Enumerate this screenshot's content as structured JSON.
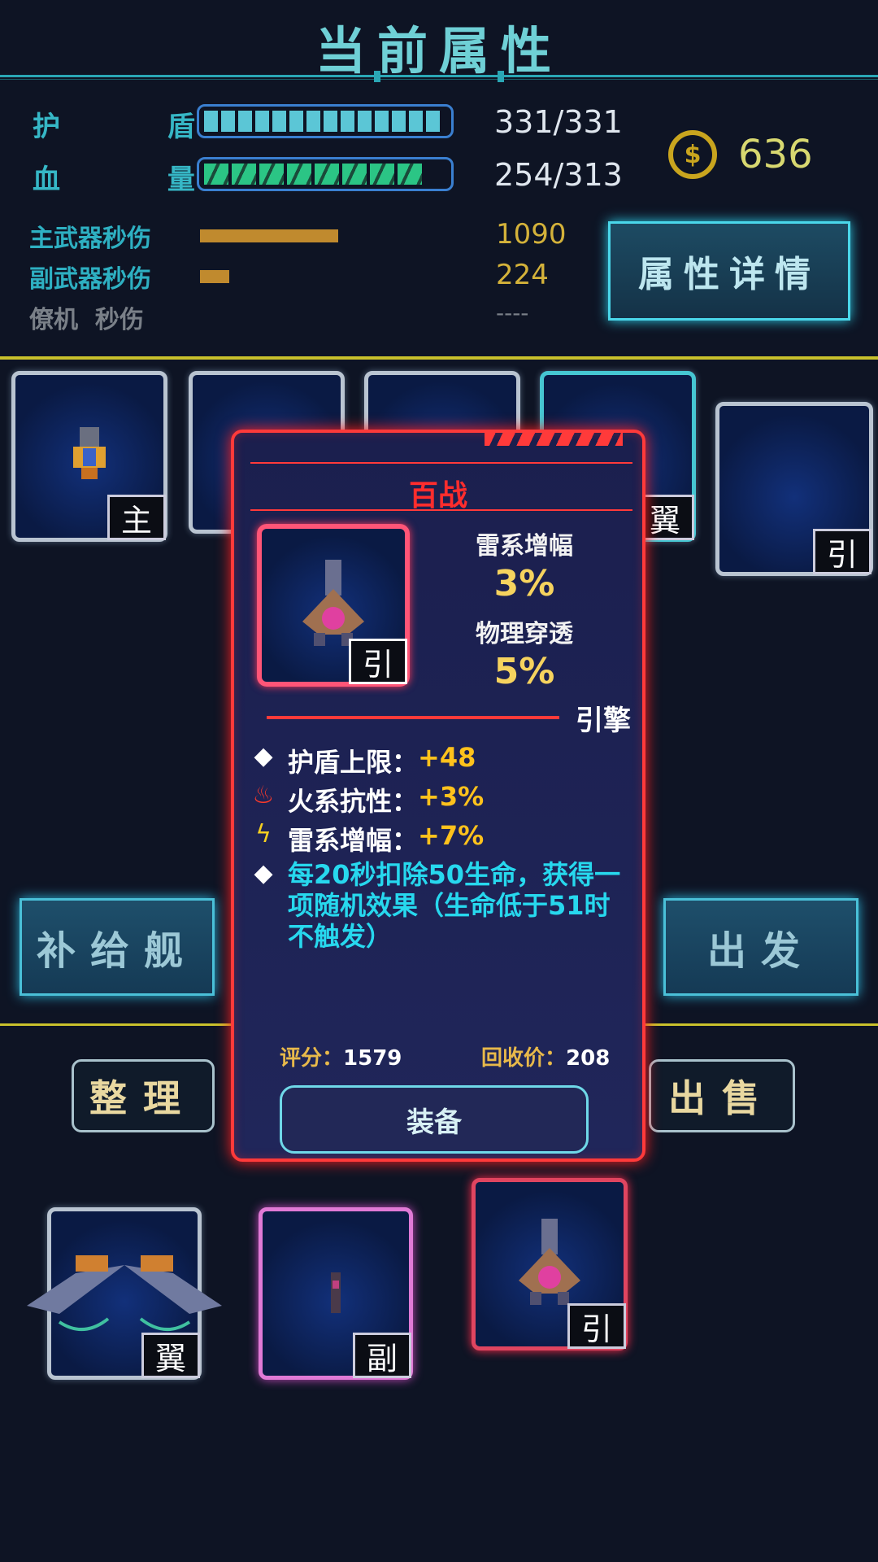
{
  "header": {
    "title": "当前属性"
  },
  "stats": {
    "shield_label": "护 盾",
    "shield_value": "331/331",
    "shield_fill": 1.0,
    "hp_label": "血 量",
    "hp_value": "254/313",
    "hp_fill": 0.81,
    "coins": "636",
    "main_weapon_label": "主武器秒伤",
    "main_weapon_value": "1090",
    "sub_weapon_label": "副武器秒伤",
    "sub_weapon_value": "224",
    "drone_label": "僚机  秒伤",
    "drone_value": "----",
    "detail_button": "属性详情"
  },
  "slots": {
    "main_tag": "主",
    "wing_tag": "翼",
    "engine_tag": "引"
  },
  "buttons": {
    "supply": "补给舰",
    "depart": "出发",
    "organize": "整理",
    "sell": "出售"
  },
  "popup": {
    "name": "百战",
    "type_tag": "引",
    "attr1_label": "雷系增幅",
    "attr1_value": "3%",
    "attr2_label": "物理穿透",
    "attr2_value": "5%",
    "type_label": "引擎",
    "effects": [
      {
        "label": "护盾上限：",
        "value": "+48",
        "icon": "diamond-icon"
      },
      {
        "label": "火系抗性：",
        "value": "+3%",
        "icon": "fire-icon"
      },
      {
        "label": "雷系增幅：",
        "value": "+7%",
        "icon": "lightning-icon"
      }
    ],
    "special": "每20秒扣除50生命，获得一项随机效果（生命低于51时不触发）",
    "score_label": "评分：",
    "score_value": "1579",
    "recycle_label": "回收价：",
    "recycle_value": "208",
    "equip_button": "装备"
  },
  "inventory": {
    "item1_tag": "翼",
    "item2_tag": "副",
    "item3_tag": "引"
  },
  "colors": {
    "accent_cyan": "#36b7c6",
    "popup_red": "#ff3a3a",
    "gold": "#f6d35e"
  }
}
